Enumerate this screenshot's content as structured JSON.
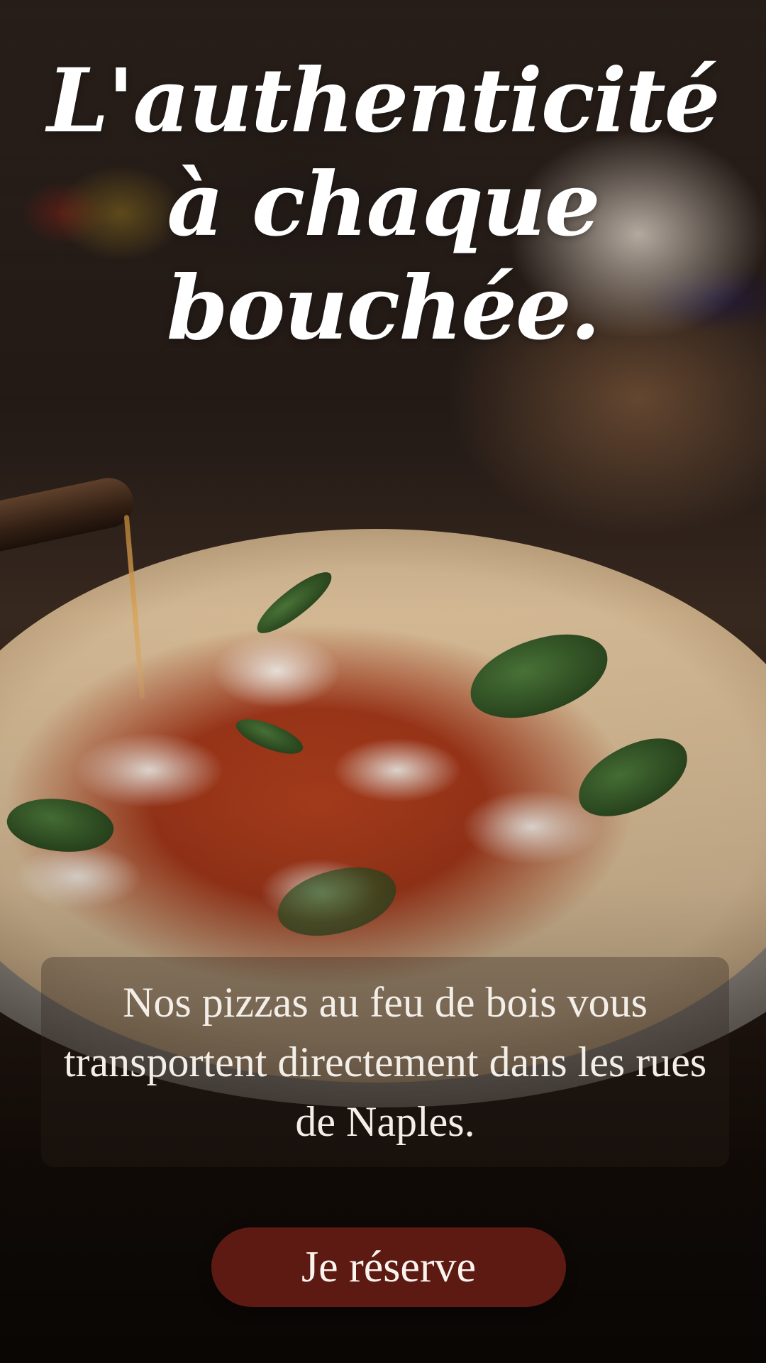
{
  "hero": {
    "title_lines": [
      "L'authenticité",
      "à chaque",
      "bouchée."
    ]
  },
  "tagline": {
    "text": "Nos pizzas au feu de bois vous transportent directement dans les rues de Naples."
  },
  "cta": {
    "label": "Je réserve"
  },
  "colors": {
    "cta_background": "#5c1a12",
    "text": "#ffffff"
  }
}
